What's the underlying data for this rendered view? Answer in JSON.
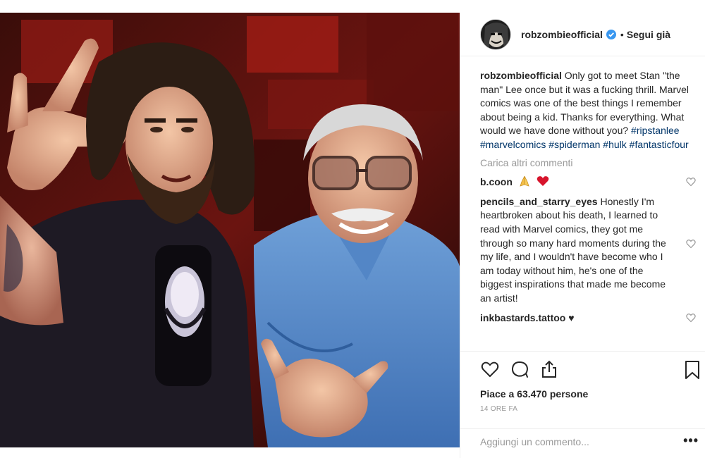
{
  "post": {
    "image_alt": "photo-of-two-men-making-horns-gesture"
  },
  "header": {
    "username": "robzombieofficial",
    "verified": true,
    "separator": "•",
    "follow_label": "Segui già"
  },
  "caption": {
    "username": "robzombieofficial",
    "text": "Only got to meet Stan \"the man\" Lee once but it was a fucking thrill. Marvel comics was one of the best things I remember about being a kid. Thanks for everything. What would we have done without you?",
    "hashtags": [
      "#ripstanlee",
      "#marvelcomics",
      "#spiderman",
      "#hulk",
      "#fantasticfour"
    ]
  },
  "load_more_label": "Carica altri commenti",
  "comments": [
    {
      "username": "b.coon",
      "text": "",
      "emojis": [
        "folded-hands-icon",
        "red-heart-icon"
      ]
    },
    {
      "username": "pencils_and_starry_eyes",
      "text": "Honestly I'm heartbroken about his death, I learned to read with Marvel comics, they got me through so many hard moments during the my life, and I wouldn't have become who I am today without him, he's one of the biggest inspirations that made me become an artist!"
    },
    {
      "username": "inkbastards.tattoo",
      "text": "♥"
    }
  ],
  "actions": {
    "likes_text": "Piace a 63.470 persone",
    "time_text": "14 ORE FA",
    "icons": [
      "heart-icon",
      "comment-icon",
      "share-icon",
      "bookmark-icon"
    ]
  },
  "comment_input": {
    "placeholder": "Aggiungi un commento...",
    "more_label": "•••"
  },
  "colors": {
    "hashtag": "#003569",
    "verified": "#3897f0",
    "muted": "#999999",
    "text": "#262626"
  }
}
